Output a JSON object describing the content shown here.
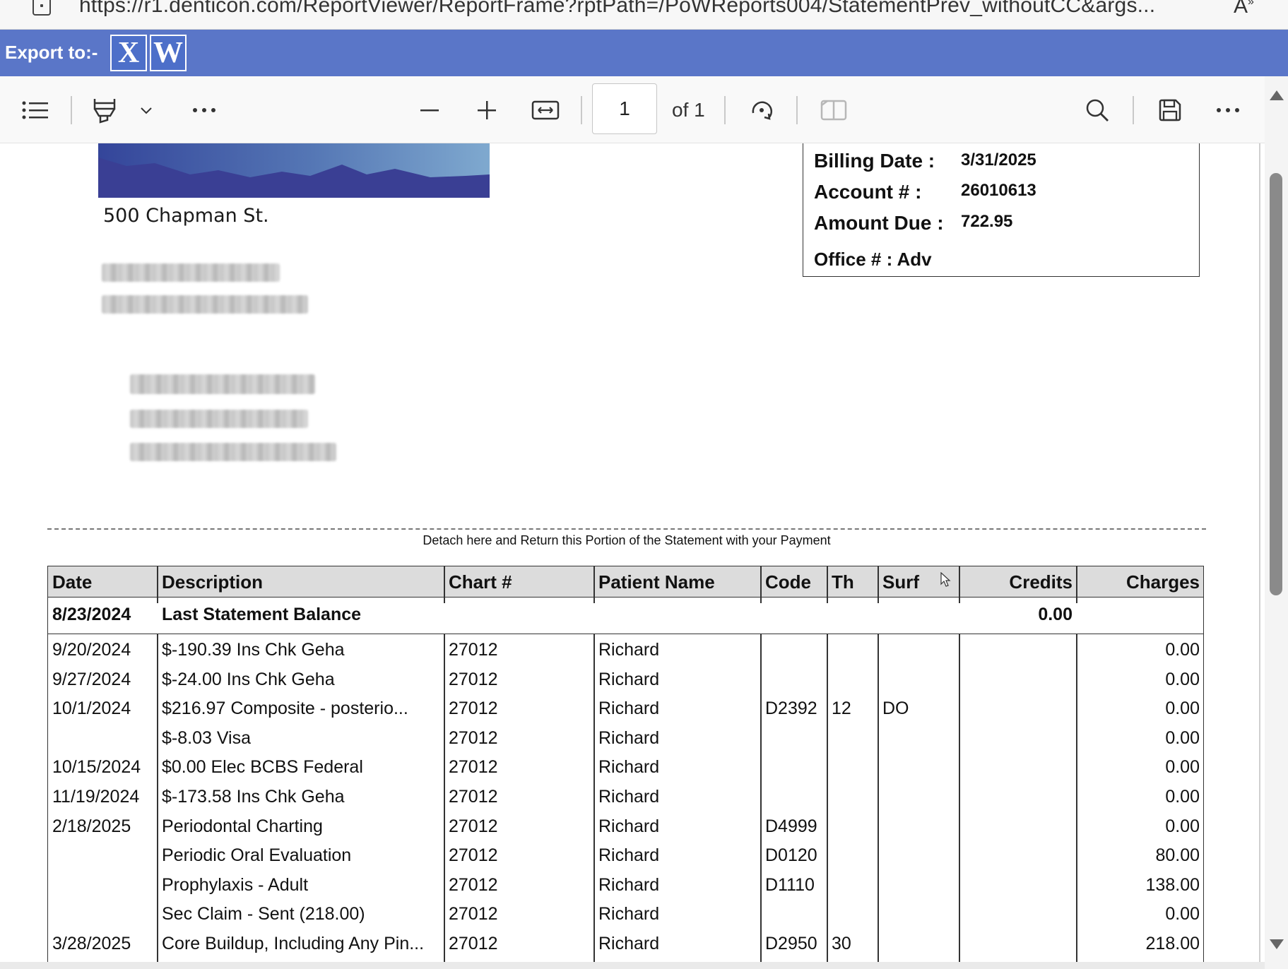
{
  "browser": {
    "url": "https://r1.denticon.com/ReportViewer/ReportFrame?rptPath=/PoWReports004/StatementPrev_withoutCC&args..."
  },
  "export_bar": {
    "label": "Export to:-",
    "excel_label": "X",
    "word_label": "W"
  },
  "pdf_toolbar": {
    "page_number": "1",
    "page_count_label": "of 1",
    "icons": [
      "contents-icon",
      "highlight-icon",
      "chevron-down-icon",
      "more-icon",
      "zoom-out-icon",
      "zoom-in-icon",
      "fit-width-icon",
      "rotate-icon",
      "page-view-icon",
      "search-icon",
      "save-icon",
      "more-options-icon"
    ]
  },
  "statement": {
    "address_line": "500 Chapman St.",
    "billing": {
      "billing_date_label": "Billing Date :",
      "billing_date": "3/31/2025",
      "account_label": "Account # :",
      "account": "26010613",
      "amount_due_label": "Amount Due :",
      "amount_due": "722.95",
      "office": "Office # : Adv"
    },
    "detach_text": "Detach here and Return this Portion of the Statement with your Payment",
    "columns": [
      "Date",
      "Description",
      "Chart #",
      "Patient Name",
      "Code",
      "Th",
      "Surf",
      "Credits",
      "Charges"
    ],
    "balance_row": {
      "date": "8/23/2024",
      "description": "Last Statement Balance",
      "credits": "0.00"
    },
    "rows": [
      {
        "date": "9/20/2024",
        "description": "$-190.39 Ins Chk Geha",
        "chart": "27012",
        "patient": "Richard",
        "code": "",
        "th": "",
        "surf": "",
        "credits": "",
        "charges": "0.00"
      },
      {
        "date": "9/27/2024",
        "description": "$-24.00 Ins Chk Geha",
        "chart": "27012",
        "patient": "Richard",
        "code": "",
        "th": "",
        "surf": "",
        "credits": "",
        "charges": "0.00"
      },
      {
        "date": "10/1/2024",
        "description": "$216.97    Composite - posterio...",
        "chart": "27012",
        "patient": "Richard",
        "code": "D2392",
        "th": "12",
        "surf": "DO",
        "credits": "",
        "charges": "0.00"
      },
      {
        "date": "",
        "description": "$-8.03 Visa",
        "chart": "27012",
        "patient": "Richard",
        "code": "",
        "th": "",
        "surf": "",
        "credits": "",
        "charges": "0.00"
      },
      {
        "date": "10/15/2024",
        "description": "$0.00 Elec BCBS Federal",
        "chart": "27012",
        "patient": "Richard",
        "code": "",
        "th": "",
        "surf": "",
        "credits": "",
        "charges": "0.00"
      },
      {
        "date": "11/19/2024",
        "description": "$-173.58 Ins Chk Geha",
        "chart": "27012",
        "patient": "Richard",
        "code": "",
        "th": "",
        "surf": "",
        "credits": "",
        "charges": "0.00"
      },
      {
        "date": "2/18/2025",
        "description": "Periodontal Charting",
        "chart": "27012",
        "patient": "Richard",
        "code": "D4999",
        "th": "",
        "surf": "",
        "credits": "",
        "charges": "0.00"
      },
      {
        "date": "",
        "description": "Periodic Oral Evaluation",
        "chart": "27012",
        "patient": "Richard",
        "code": "D0120",
        "th": "",
        "surf": "",
        "credits": "",
        "charges": "80.00"
      },
      {
        "date": "",
        "description": "Prophylaxis - Adult",
        "chart": "27012",
        "patient": "Richard",
        "code": "D1110",
        "th": "",
        "surf": "",
        "credits": "",
        "charges": "138.00"
      },
      {
        "date": "",
        "description": "Sec Claim - Sent  (218.00)",
        "chart": "27012",
        "patient": "Richard",
        "code": "",
        "th": "",
        "surf": "",
        "credits": "",
        "charges": "0.00"
      },
      {
        "date": "3/28/2025",
        "description": "Core Buildup, Including Any Pin...",
        "chart": "27012",
        "patient": "Richard",
        "code": "D2950",
        "th": "30",
        "surf": "",
        "credits": "",
        "charges": "218.00"
      }
    ]
  }
}
